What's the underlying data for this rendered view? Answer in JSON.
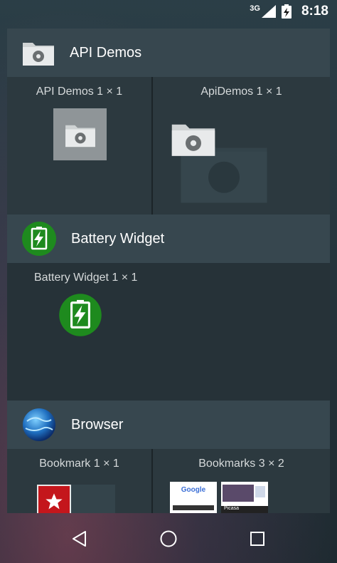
{
  "status_bar": {
    "network": "3G",
    "time": "8:18"
  },
  "sections": [
    {
      "app_name": "API Demos",
      "icon": "folder-gear-icon",
      "widgets": [
        {
          "label": "API Demos  1 × 1"
        },
        {
          "label": "ApiDemos  1 × 1"
        }
      ]
    },
    {
      "app_name": "Battery Widget",
      "icon": "battery-bolt-icon",
      "widgets": [
        {
          "label": "Battery Widget  1 × 1"
        }
      ]
    },
    {
      "app_name": "Browser",
      "icon": "globe-icon",
      "widgets": [
        {
          "label": "Bookmark  1 × 1"
        },
        {
          "label": "Bookmarks  3 × 2"
        }
      ],
      "preview_labels": [
        "Google",
        "Picasa"
      ]
    }
  ],
  "nav_bar": {
    "back": "back-icon",
    "home": "home-icon",
    "recents": "recents-icon"
  },
  "colors": {
    "header_bg": "#37474f",
    "body_bg": "#263238",
    "battery_green": "#1e8a1e"
  }
}
